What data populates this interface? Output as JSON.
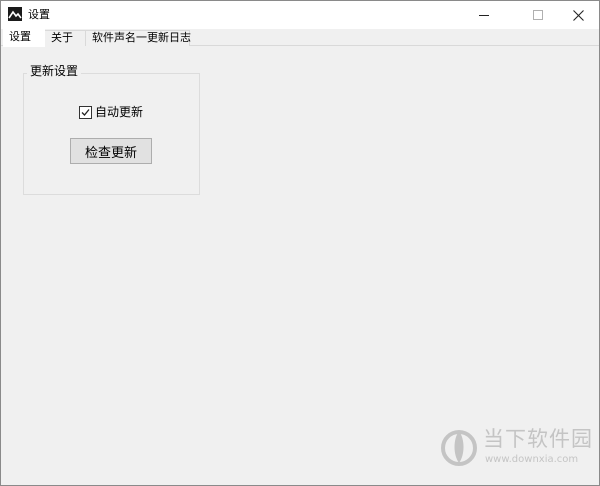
{
  "window": {
    "title": "设置",
    "icon": "app-image-icon"
  },
  "tabs": [
    {
      "label": "设置",
      "active": true
    },
    {
      "label": "关于",
      "active": false
    },
    {
      "label": "软件声名一更新日志",
      "active": false
    }
  ],
  "update_group": {
    "title": "更新设置",
    "auto_update": {
      "label": "自动更新",
      "checked": true
    },
    "check_button": "检查更新"
  },
  "watermark": {
    "name": "当下软件园",
    "url": "www.downxia.com"
  },
  "colors": {
    "background": "#f0f0f0",
    "titlebar": "#ffffff",
    "button": "#e1e1e1"
  }
}
